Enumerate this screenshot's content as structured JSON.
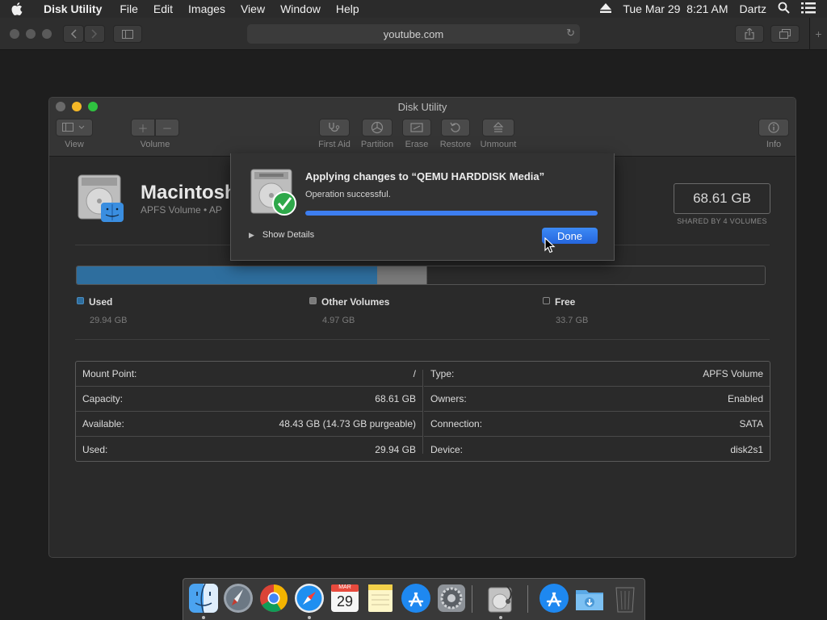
{
  "menubar": {
    "app_name": "Disk Utility",
    "items": [
      "File",
      "Edit",
      "Images",
      "View",
      "Window",
      "Help"
    ],
    "datetime": "Tue Mar 29  8:21 AM",
    "user": "Dartz"
  },
  "browser": {
    "url": "youtube.com"
  },
  "window": {
    "title": "Disk Utility",
    "toolbar": {
      "view": "View",
      "volume": "Volume",
      "first_aid": "First Aid",
      "partition": "Partition",
      "erase": "Erase",
      "restore": "Restore",
      "unmount": "Unmount",
      "info": "Info"
    },
    "volume": {
      "name": "Macintosh",
      "subtitle": "APFS Volume • AP",
      "size": "68.61 GB",
      "size_caption": "SHARED BY 4 VOLUMES"
    },
    "usage": {
      "segments": [
        {
          "name": "Used",
          "value": "29.94 GB",
          "fraction": 0.437,
          "color": "#2e6e9e"
        },
        {
          "name": "Other Volumes",
          "value": "4.97 GB",
          "fraction": 0.072,
          "color": "#7a7a7a"
        },
        {
          "name": "Free",
          "value": "33.7 GB",
          "fraction": 0.491,
          "color": "#2c2c2c"
        }
      ]
    },
    "info_left": [
      {
        "label": "Mount Point:",
        "value": "/"
      },
      {
        "label": "Capacity:",
        "value": "68.61 GB"
      },
      {
        "label": "Available:",
        "value": "48.43 GB (14.73 GB purgeable)"
      },
      {
        "label": "Used:",
        "value": "29.94 GB"
      }
    ],
    "info_right": [
      {
        "label": "Type:",
        "value": "APFS Volume"
      },
      {
        "label": "Owners:",
        "value": "Enabled"
      },
      {
        "label": "Connection:",
        "value": "SATA"
      },
      {
        "label": "Device:",
        "value": "disk2s1"
      }
    ]
  },
  "sheet": {
    "title": "Applying changes to “QEMU HARDDISK Media”",
    "status": "Operation successful.",
    "progress": 1.0,
    "show_details": "Show Details",
    "done": "Done"
  },
  "dock": {
    "calendar_month": "MAR",
    "calendar_day": "29"
  },
  "colors": {
    "accent": "#2566de",
    "used": "#2e6e9e",
    "other": "#7a7a7a"
  }
}
